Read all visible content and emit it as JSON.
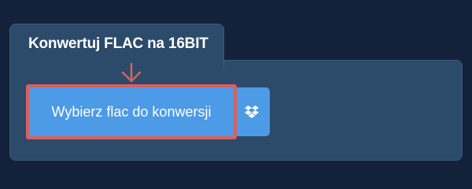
{
  "tab": {
    "title": "Konwertuj FLAC na 16BIT"
  },
  "upload": {
    "choose_label": "Wybierz flac do konwersji",
    "dropbox_icon": "dropbox-icon"
  },
  "annotation": {
    "arrow_icon": "arrow-down-icon",
    "highlight_color": "#d9605e"
  },
  "colors": {
    "background": "#13223a",
    "panel": "#2c4a6a",
    "button": "#4d9ae6"
  }
}
